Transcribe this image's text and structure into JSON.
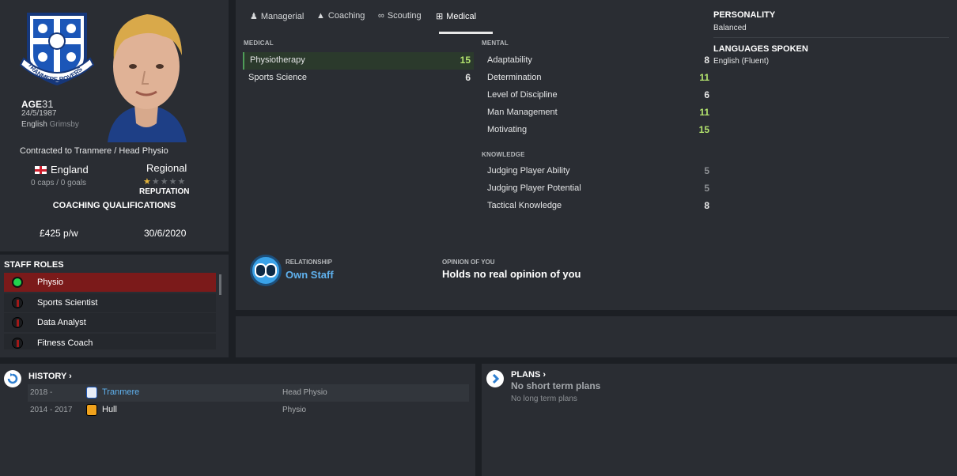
{
  "profile": {
    "club_badge_text": "TRANMERE ROVERS",
    "age_label": "AGE",
    "age": "31",
    "dob": "24/5/1987",
    "nationality": "English",
    "birthplace": "Grimsby",
    "contract": "Contracted to Tranmere / Head Physio",
    "country": "England",
    "caps": "0 caps / 0 goals",
    "reputation_level": "Regional",
    "reputation_stars": 1,
    "reputation_max": 5,
    "reputation_label": "REPUTATION",
    "coaching_qualifications_label": "COACHING QUALIFICATIONS",
    "wage": "£425 p/w",
    "contract_expiry": "30/6/2020"
  },
  "staff_roles": {
    "title": "STAFF ROLES",
    "items": [
      {
        "label": "Physio",
        "active": true
      },
      {
        "label": "Sports Scientist",
        "active": false
      },
      {
        "label": "Data Analyst",
        "active": false
      },
      {
        "label": "Fitness Coach",
        "active": false
      }
    ]
  },
  "tabs": [
    {
      "label": "Managerial",
      "icon": "managerial-icon"
    },
    {
      "label": "Coaching",
      "icon": "coaching-icon"
    },
    {
      "label": "Scouting",
      "icon": "binoculars-icon"
    },
    {
      "label": "Medical",
      "icon": "medical-kit-icon",
      "active": true
    }
  ],
  "medical": {
    "title": "MEDICAL",
    "items": [
      {
        "name": "Physiotherapy",
        "value": "15"
      },
      {
        "name": "Sports Science",
        "value": "6"
      }
    ]
  },
  "mental": {
    "title": "MENTAL",
    "items": [
      {
        "name": "Adaptability",
        "value": "8"
      },
      {
        "name": "Determination",
        "value": "11"
      },
      {
        "name": "Level of Discipline",
        "value": "6"
      },
      {
        "name": "Man Management",
        "value": "11"
      },
      {
        "name": "Motivating",
        "value": "15"
      }
    ]
  },
  "knowledge": {
    "title": "KNOWLEDGE",
    "items": [
      {
        "name": "Judging Player Ability",
        "value": "5"
      },
      {
        "name": "Judging Player Potential",
        "value": "5"
      },
      {
        "name": "Tactical Knowledge",
        "value": "8"
      }
    ]
  },
  "personality": {
    "title": "PERSONALITY",
    "value": "Balanced"
  },
  "languages": {
    "title": "LANGUAGES SPOKEN",
    "value": "English (Fluent)"
  },
  "relationship": {
    "label": "RELATIONSHIP",
    "value": "Own Staff"
  },
  "opinion": {
    "label": "OPINION OF YOU",
    "value": "Holds no real opinion of you"
  },
  "history": {
    "title": "HISTORY",
    "rows": [
      {
        "years": "2018 -",
        "club": "Tranmere",
        "job": "Head Physio"
      },
      {
        "years": "2014 - 2017",
        "club": "Hull",
        "job": "Physio"
      }
    ]
  },
  "plans": {
    "title": "PLANS",
    "short_term": "No short term plans",
    "long_term": "No long term plans"
  },
  "colors": {
    "accent_green": "#b4e46e",
    "role_active": "#7b1a1a",
    "link_blue": "#5fb1ee"
  }
}
